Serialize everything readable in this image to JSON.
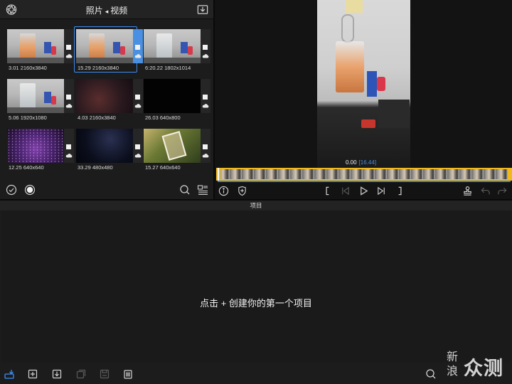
{
  "library": {
    "title_left": "照片",
    "title_sep": "◂",
    "title_right": "视频",
    "items": [
      {
        "duration": "3.01",
        "resolution": "2160x3840",
        "thumb": "glass-orange",
        "selected": false
      },
      {
        "duration": "15.29",
        "resolution": "2160x3840",
        "thumb": "glass-orange",
        "selected": true
      },
      {
        "duration": "6:20.22",
        "resolution": "1802x1014",
        "thumb": "glass-clear",
        "selected": false
      },
      {
        "duration": "5.06",
        "resolution": "1920x1080",
        "thumb": "glass-clear",
        "selected": false
      },
      {
        "duration": "4.03",
        "resolution": "2160x3840",
        "thumb": "night",
        "selected": false
      },
      {
        "duration": "26.03",
        "resolution": "640x800",
        "thumb": "black",
        "selected": false
      },
      {
        "duration": "12.25",
        "resolution": "640x640",
        "thumb": "purple-lights",
        "selected": false
      },
      {
        "duration": "33.29",
        "resolution": "480x480",
        "thumb": "dark-sky",
        "selected": false
      },
      {
        "duration": "15.27",
        "resolution": "640x640",
        "thumb": "forest-frame",
        "selected": false
      }
    ],
    "toolbar": {
      "left_icons": [
        "checkmark-circle-icon",
        "record-circle-icon"
      ],
      "right_icons": [
        "search-icon",
        "list-view-icon"
      ]
    }
  },
  "preview": {
    "time_current": "0.00",
    "time_total": "[16.44]",
    "accent_color": "#4a90e2",
    "trim_color": "#f0b81a"
  },
  "project": {
    "title": "项目",
    "empty_message": "点击 + 创建你的第一个项目"
  },
  "watermark": {
    "logo_text": "新浪",
    "text": "众测"
  }
}
